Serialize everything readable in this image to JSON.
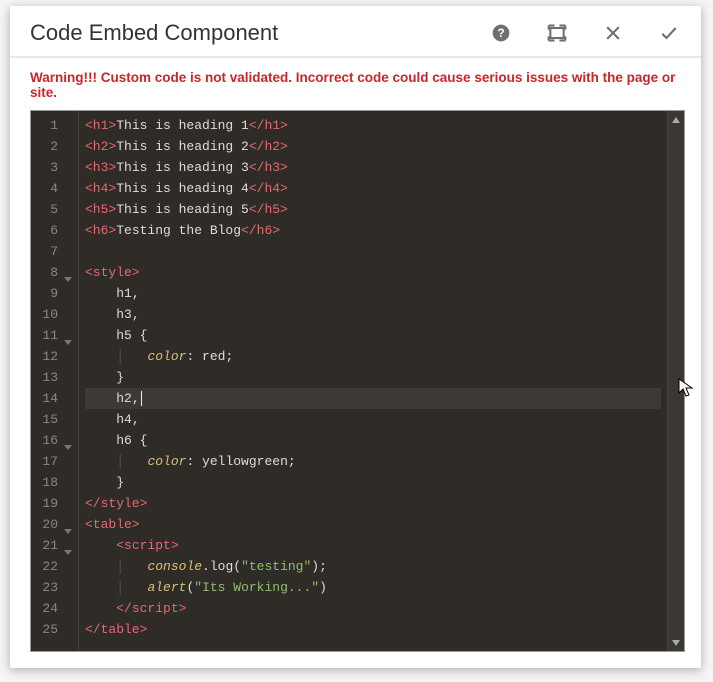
{
  "header": {
    "title": "Code Embed Component"
  },
  "warning": "Warning!!! Custom code is not validated. Incorrect code could cause serious issues with the page or site.",
  "editor": {
    "activeLine": 14,
    "lines": [
      {
        "num": 1,
        "fold": false,
        "tokens": [
          [
            "tag",
            "<h1>"
          ],
          [
            "text",
            "This is heading 1"
          ],
          [
            "tag",
            "</h1>"
          ]
        ]
      },
      {
        "num": 2,
        "fold": false,
        "tokens": [
          [
            "tag",
            "<h2>"
          ],
          [
            "text",
            "This is heading 2"
          ],
          [
            "tag",
            "</h2>"
          ]
        ]
      },
      {
        "num": 3,
        "fold": false,
        "tokens": [
          [
            "tag",
            "<h3>"
          ],
          [
            "text",
            "This is heading 3"
          ],
          [
            "tag",
            "</h3>"
          ]
        ]
      },
      {
        "num": 4,
        "fold": false,
        "tokens": [
          [
            "tag",
            "<h4>"
          ],
          [
            "text",
            "This is heading 4"
          ],
          [
            "tag",
            "</h4>"
          ]
        ]
      },
      {
        "num": 5,
        "fold": false,
        "tokens": [
          [
            "tag",
            "<h5>"
          ],
          [
            "text",
            "This is heading 5"
          ],
          [
            "tag",
            "</h5>"
          ]
        ]
      },
      {
        "num": 6,
        "fold": false,
        "tokens": [
          [
            "tag",
            "<h6>"
          ],
          [
            "text",
            "Testing the Blog"
          ],
          [
            "tag",
            "</h6>"
          ]
        ]
      },
      {
        "num": 7,
        "fold": false,
        "tokens": []
      },
      {
        "num": 8,
        "fold": true,
        "tokens": [
          [
            "tag",
            "<style>"
          ]
        ]
      },
      {
        "num": 9,
        "fold": false,
        "tokens": [
          [
            "indent",
            "    "
          ],
          [
            "sel",
            "h1,"
          ]
        ]
      },
      {
        "num": 10,
        "fold": false,
        "tokens": [
          [
            "indent",
            "    "
          ],
          [
            "sel",
            "h3,"
          ]
        ]
      },
      {
        "num": 11,
        "fold": true,
        "tokens": [
          [
            "indent",
            "    "
          ],
          [
            "sel",
            "h5 "
          ],
          [
            "brace",
            "{"
          ]
        ]
      },
      {
        "num": 12,
        "fold": false,
        "tokens": [
          [
            "indent",
            "    "
          ],
          [
            "guide",
            "│   "
          ],
          [
            "prop",
            "color"
          ],
          [
            "text",
            ": red;"
          ]
        ]
      },
      {
        "num": 13,
        "fold": false,
        "tokens": [
          [
            "indent",
            "    "
          ],
          [
            "brace",
            "}"
          ]
        ]
      },
      {
        "num": 14,
        "fold": false,
        "tokens": [
          [
            "indent",
            "    "
          ],
          [
            "sel",
            "h2,"
          ],
          [
            "cursor",
            ""
          ]
        ]
      },
      {
        "num": 15,
        "fold": false,
        "tokens": [
          [
            "indent",
            "    "
          ],
          [
            "sel",
            "h4,"
          ]
        ]
      },
      {
        "num": 16,
        "fold": true,
        "tokens": [
          [
            "indent",
            "    "
          ],
          [
            "sel",
            "h6 "
          ],
          [
            "brace",
            "{"
          ]
        ]
      },
      {
        "num": 17,
        "fold": false,
        "tokens": [
          [
            "indent",
            "    "
          ],
          [
            "guide",
            "│   "
          ],
          [
            "prop",
            "color"
          ],
          [
            "text",
            ": yellowgreen;"
          ]
        ]
      },
      {
        "num": 18,
        "fold": false,
        "tokens": [
          [
            "indent",
            "    "
          ],
          [
            "brace",
            "}"
          ]
        ]
      },
      {
        "num": 19,
        "fold": false,
        "tokens": [
          [
            "tag",
            "</style>"
          ]
        ]
      },
      {
        "num": 20,
        "fold": true,
        "tokens": [
          [
            "tag",
            "<table>"
          ]
        ]
      },
      {
        "num": 21,
        "fold": true,
        "tokens": [
          [
            "indent",
            "    "
          ],
          [
            "tag",
            "<script>"
          ]
        ]
      },
      {
        "num": 22,
        "fold": false,
        "tokens": [
          [
            "indent",
            "    "
          ],
          [
            "guide",
            "│   "
          ],
          [
            "func",
            "console"
          ],
          [
            "text",
            ".log("
          ],
          [
            "str",
            "\"testing\""
          ],
          [
            "text",
            ");"
          ]
        ]
      },
      {
        "num": 23,
        "fold": false,
        "tokens": [
          [
            "indent",
            "    "
          ],
          [
            "guide",
            "│   "
          ],
          [
            "func",
            "alert"
          ],
          [
            "text",
            "("
          ],
          [
            "str",
            "\"Its Working...\""
          ],
          [
            "text",
            ")"
          ]
        ]
      },
      {
        "num": 24,
        "fold": false,
        "tokens": [
          [
            "indent",
            "    "
          ],
          [
            "tag",
            "</script>"
          ]
        ]
      },
      {
        "num": 25,
        "fold": false,
        "tokens": [
          [
            "tag",
            "</table>"
          ]
        ]
      }
    ]
  }
}
